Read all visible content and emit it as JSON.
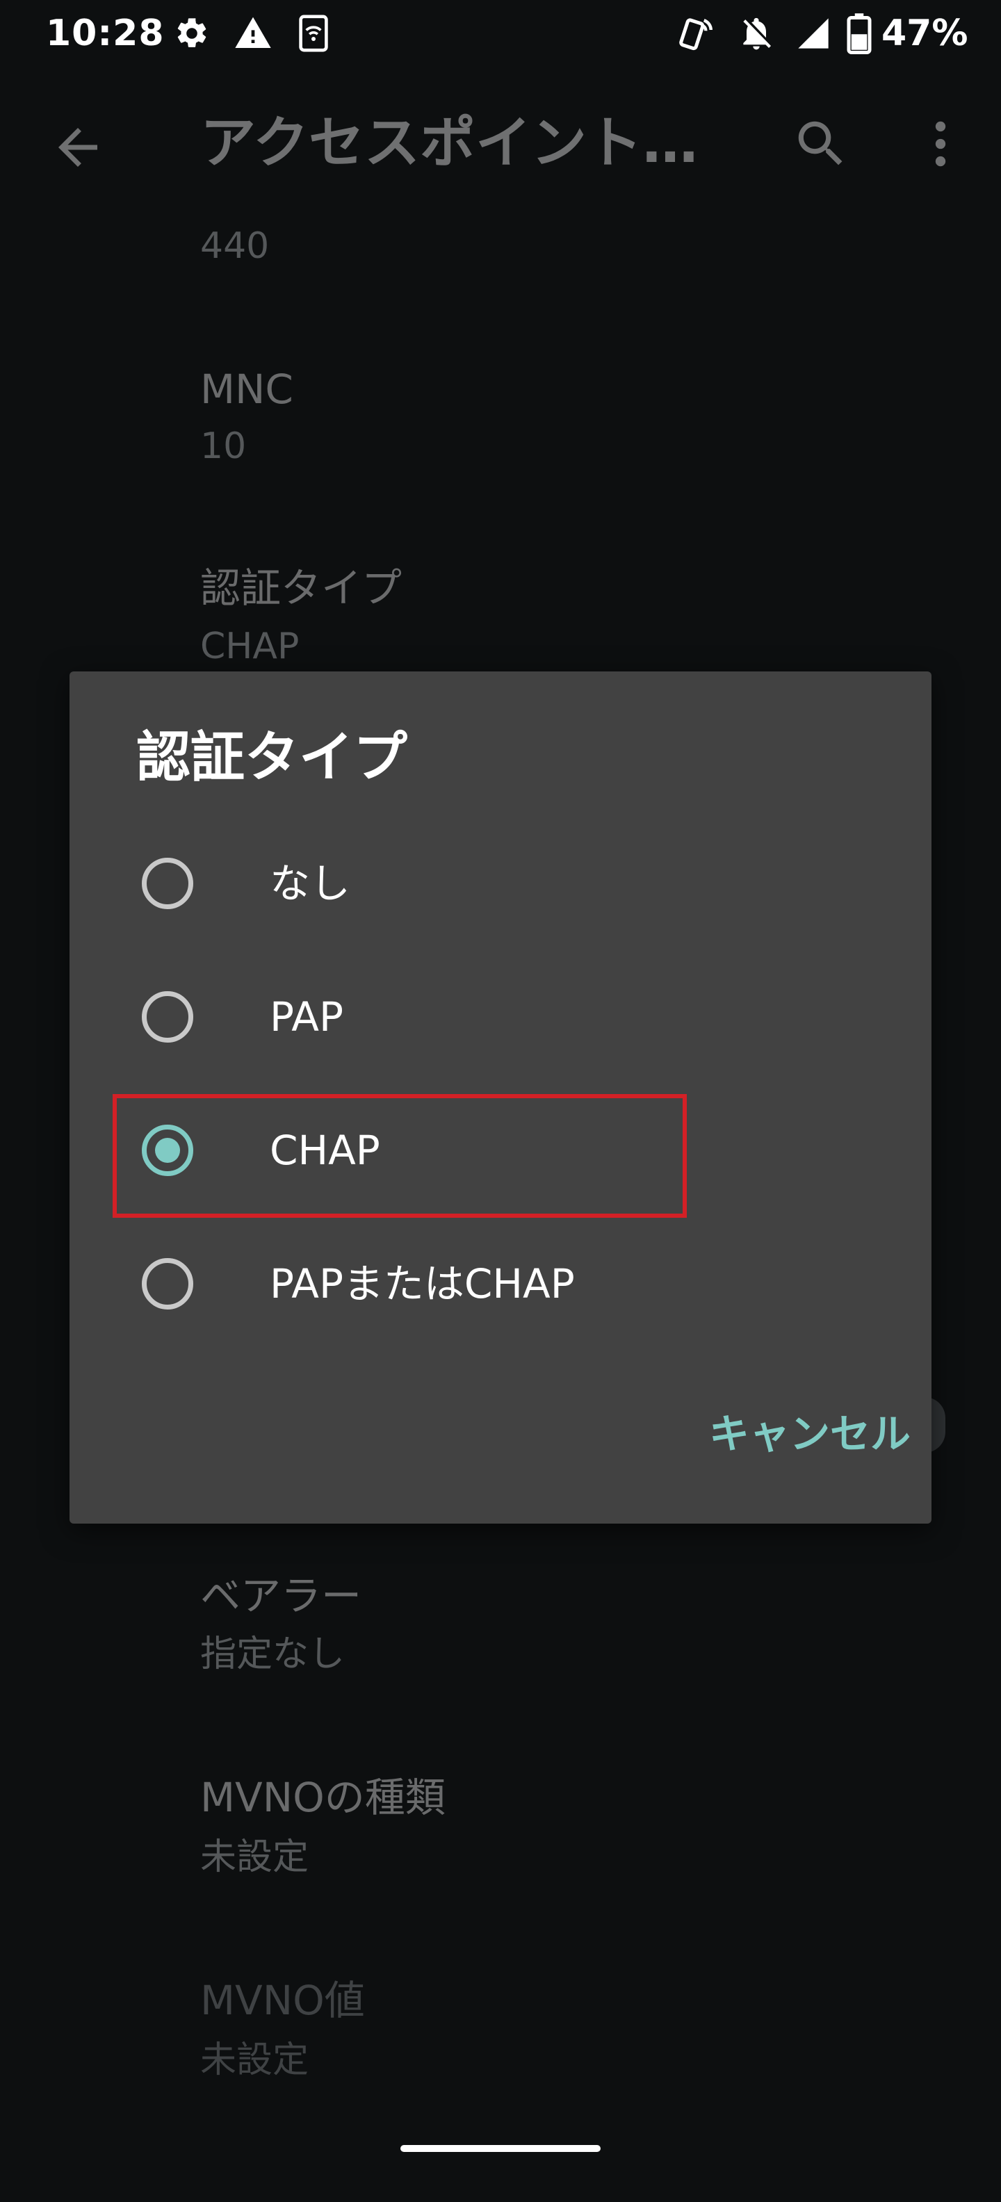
{
  "status_bar": {
    "time": "10:28",
    "battery_percent": "47%",
    "icons": [
      "settings-icon",
      "warning-icon",
      "wifi-device-icon",
      "nfc-icon",
      "notifications-off-icon",
      "signal-icon",
      "battery-icon"
    ]
  },
  "app_bar": {
    "title": "アクセスポイント…",
    "icons": [
      "back-arrow-icon",
      "search-icon",
      "more-vert-icon"
    ]
  },
  "settings": {
    "mcc_value": "440",
    "mnc": {
      "title": "MNC",
      "value": "10"
    },
    "auth": {
      "title": "認証タイプ",
      "value": "CHAP"
    },
    "bearer": {
      "title": "ベアラー",
      "value": "指定なし"
    },
    "mvno_type": {
      "title": "MVNOの種類",
      "value": "未設定"
    },
    "mvno_value": {
      "title": "MVNO値",
      "value": "未設定"
    }
  },
  "dialog": {
    "title": "認証タイプ",
    "options": [
      {
        "label": "なし",
        "checked": false
      },
      {
        "label": "PAP",
        "checked": false
      },
      {
        "label": "CHAP",
        "checked": true
      },
      {
        "label": "PAPまたはCHAP",
        "checked": false
      }
    ],
    "cancel_label": "キャンセル"
  },
  "colors": {
    "background": "#0d0f10",
    "dialog": "#424242",
    "accent": "#80cbc4",
    "highlight": "#d32026"
  }
}
